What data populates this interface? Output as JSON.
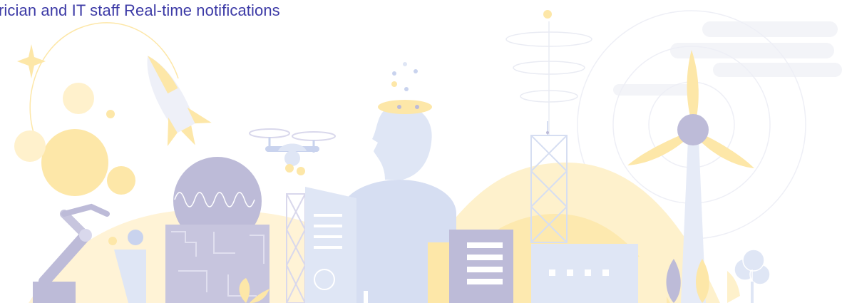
{
  "caption": {
    "text": "rician and IT staff Real-time notifications",
    "color": "#3c3aa6"
  },
  "palette": {
    "yellow": "#fde7a8",
    "yellow_soft": "#fef1cc",
    "yellow_pale": "#fff7e3",
    "lavender": "#bdbbd8",
    "lavender_light": "#d9d8ec",
    "blue_pale": "#dfe6f5",
    "blue_light": "#c9d3ee",
    "cloud": "#f3f4f8"
  },
  "icons": [
    "star-icon",
    "rocket-icon",
    "planet-icon",
    "satellite-tower-icon",
    "drone-icon",
    "brain-head-icon",
    "robot-arm-icon",
    "globe-wave-icon",
    "lattice-tower-icon",
    "wind-turbine-icon",
    "cloud-icon",
    "tree-icon",
    "leaf-icon"
  ]
}
